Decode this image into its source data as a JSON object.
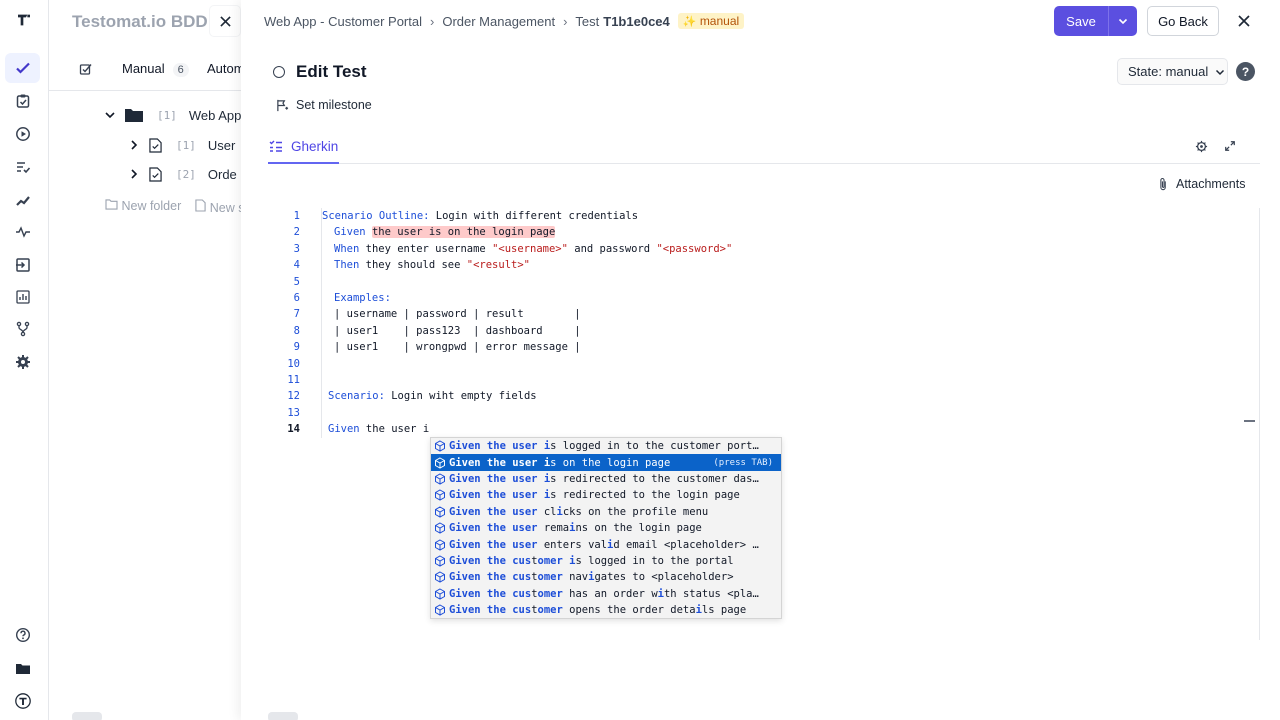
{
  "colors": {
    "accent": "#5b4fe0",
    "keyword": "#1d4ed8",
    "string": "#b91c1c",
    "highlight": "#fecaca",
    "selected_suggestion": "#0b63c9"
  },
  "rail": {
    "logo": "testomat-logo",
    "items": [
      "check-icon",
      "clipboard-check-icon",
      "play-circle-icon",
      "list-check-icon",
      "trend-icon",
      "pulse-icon",
      "import-icon",
      "bar-chart-icon",
      "branch-icon",
      "gear-icon"
    ],
    "bottom": [
      "help-circle-icon",
      "folder-icon",
      "testomat-round-logo"
    ]
  },
  "project": {
    "title": "Testomat.io BDD",
    "tabs": [
      {
        "label": "Manual",
        "count": "6"
      },
      {
        "label": "Autom"
      }
    ],
    "tree": [
      {
        "num": "[1]",
        "name": "Web App"
      },
      {
        "num": "[1]",
        "name": "User"
      },
      {
        "num": "[2]",
        "name": "Orde"
      }
    ],
    "new_folder": "New folder",
    "new_suite": "New s"
  },
  "header": {
    "breadcrumbs": [
      "Web App - Customer Portal",
      "Order Management",
      "Test"
    ],
    "test_id": "T1b1e0ce4",
    "badge": "manual",
    "save": "Save",
    "go_back": "Go Back"
  },
  "edit": {
    "title": "Edit Test",
    "state": "State: manual",
    "help": "?",
    "milestone": "Set milestone",
    "tab": "Gherkin",
    "attachments": "Attachments"
  },
  "editor": {
    "line_numbers": [
      "1",
      "2",
      "3",
      "4",
      "5",
      "6",
      "7",
      "8",
      "9",
      "10",
      "11",
      "12",
      "13",
      "14"
    ],
    "l1_kw": "Scenario Outline:",
    "l1_text": " Login with different credentials",
    "l2_kw": "Given",
    "l2_hl": "the user is on the login page",
    "l3_kw": "When",
    "l3_a": " they enter username ",
    "l3_s1": "\"<username>\"",
    "l3_b": " and password ",
    "l3_s2": "\"<password>\"",
    "l4_kw": "Then",
    "l4_a": " they should see ",
    "l4_s": "\"<result>\"",
    "l6_kw": "Examples:",
    "l7": "| username | password | result        |",
    "l8": "| user1    | pass123  | dashboard     |",
    "l9": "| user1    | wrongpwd | error message |",
    "l12_kw": "Scenario:",
    "l12_text": " Login wiht empty fields",
    "l14_kw": "Given",
    "l14_text": " the user i"
  },
  "suggestions": {
    "hint": "(press TAB)",
    "items": [
      {
        "m1": "Given the user ",
        "m2": "i",
        "rest": "s logged in to the customer port…"
      },
      {
        "m1": "Given the user ",
        "m2": "i",
        "rest": "s on the login page"
      },
      {
        "m1": "Given the user ",
        "m2": "i",
        "rest": "s redirected to the customer das…"
      },
      {
        "m1": "Given the user ",
        "m2": "i",
        "rest": "s redirected to the login page"
      },
      {
        "m1": "Given the user ",
        "m2": "",
        "rest": "cl",
        "m3": "i",
        "rest2": "cks on the profile menu"
      },
      {
        "m1": "Given the user ",
        "m2": "",
        "rest": "rema",
        "m3": "i",
        "rest2": "ns on the login page"
      },
      {
        "m1": "Given the user ",
        "m2": "",
        "rest": "enters val",
        "m3": "i",
        "rest2": "d email <placeholder> …"
      },
      {
        "m1": "Given the ",
        "cus1": "cus",
        "t": "t",
        "om": "om",
        "er": "er",
        "rest": " ",
        "m3": "i",
        "rest2": "s logged in to the portal"
      },
      {
        "m1": "Given the ",
        "cus1": "cus",
        "t": "t",
        "om": "om",
        "er": "er",
        "rest": " nav",
        "m3": "i",
        "rest2": "gates to <placeholder>"
      },
      {
        "m1": "Given the ",
        "cus1": "cus",
        "t": "t",
        "om": "om",
        "er": "er",
        "rest": " has an order w",
        "m3": "i",
        "rest2": "th status <pla…"
      },
      {
        "m1": "Given the ",
        "cus1": "cus",
        "t": "t",
        "om": "om",
        "er": "er",
        "rest": " opens the order deta",
        "m3": "i",
        "rest2": "ls page"
      }
    ]
  }
}
